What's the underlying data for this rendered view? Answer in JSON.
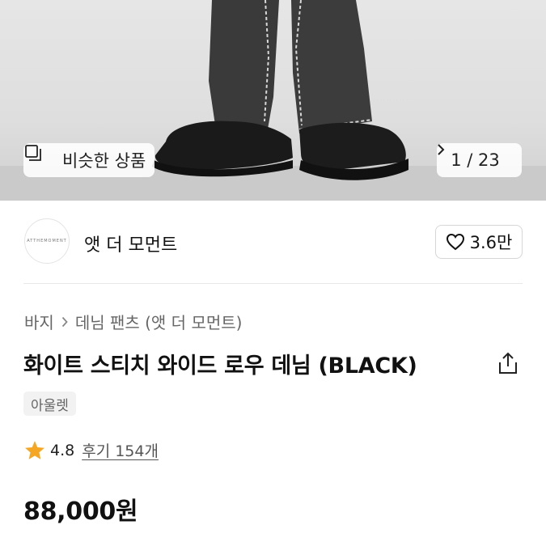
{
  "hero": {
    "similar_label": "비슷한 상품",
    "counter": "1 / 23"
  },
  "brand": {
    "logo_text": "ATTHEMOMENT",
    "name": "앳 더 모먼트",
    "likes": "3.6만"
  },
  "breadcrumb": [
    "바지",
    "데님 팬츠 (앳 더 모먼트)"
  ],
  "product": {
    "title": "화이트 스티치 와이드 로우 데님 (BLACK)",
    "badge": "아울렛",
    "rating": "4.8",
    "reviews": "후기 154개",
    "price": "88,000원"
  },
  "colors": {
    "star": "#f5a623"
  }
}
